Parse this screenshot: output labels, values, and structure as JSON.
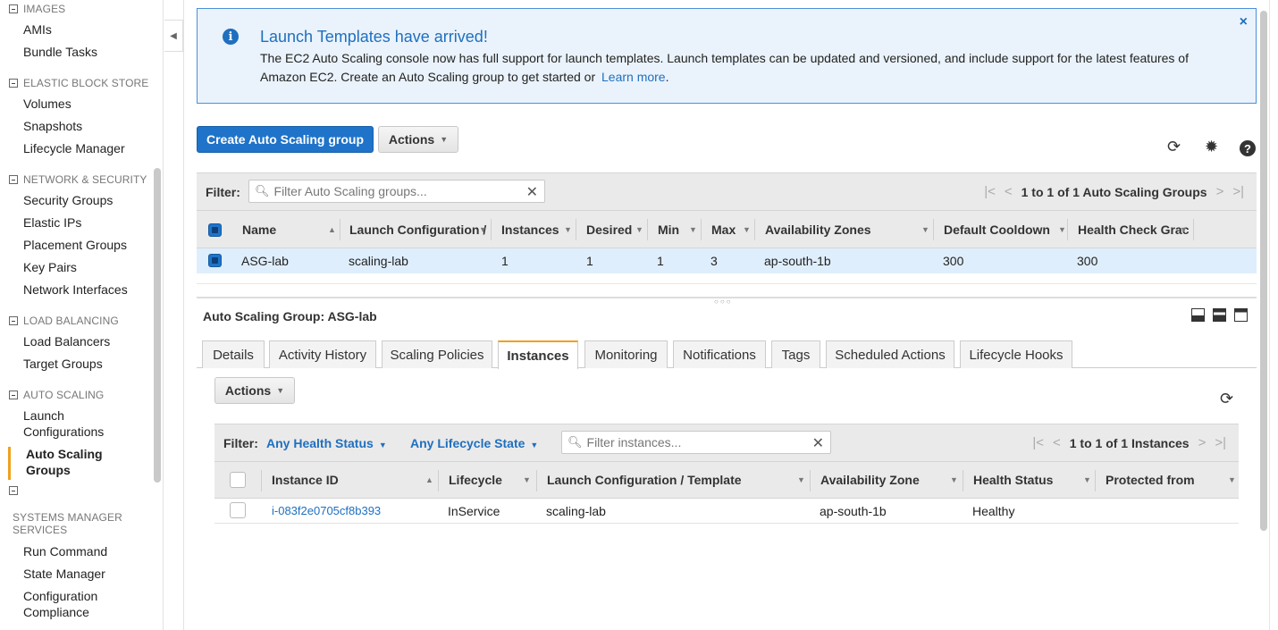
{
  "sidebar": {
    "images_section": "IMAGES",
    "images_items": [
      "AMIs",
      "Bundle Tasks"
    ],
    "ebs_section": "ELASTIC BLOCK STORE",
    "ebs_items": [
      "Volumes",
      "Snapshots",
      "Lifecycle Manager"
    ],
    "network_section": "NETWORK & SECURITY",
    "network_items": [
      "Security Groups",
      "Elastic IPs",
      "Placement Groups",
      "Key Pairs",
      "Network Interfaces"
    ],
    "lb_section": "LOAD BALANCING",
    "lb_items": [
      "Load Balancers",
      "Target Groups"
    ],
    "as_section": "AUTO SCALING",
    "as_items": [
      "Launch Configurations",
      "Auto Scaling Groups"
    ],
    "ssm_section": "SYSTEMS MANAGER SERVICES",
    "ssm_items": [
      "Run Command",
      "State Manager",
      "Configuration Compliance"
    ]
  },
  "banner": {
    "title": "Launch Templates have arrived!",
    "text": "The EC2 Auto Scaling console now has full support for launch templates. Launch templates can be updated and versioned, and include support for the latest features of Amazon EC2. Create an Auto Scaling group to get started or",
    "link": "Learn more",
    "link_suffix": ".",
    "close": "×"
  },
  "toolbar": {
    "create_label": "Create Auto Scaling group",
    "actions_label": "Actions"
  },
  "groups_filter": {
    "label": "Filter:",
    "placeholder": "Filter Auto Scaling groups...",
    "pager_text": "1 to 1 of 1 Auto Scaling Groups"
  },
  "groups_table": {
    "columns": [
      "Name",
      "Launch Configuration /",
      "Instances",
      "Desired",
      "Min",
      "Max",
      "Availability Zones",
      "Default Cooldown",
      "Health Check Grac"
    ],
    "rows": [
      {
        "name": "ASG-lab",
        "launch_config": "scaling-lab",
        "instances": "1",
        "desired": "1",
        "min": "1",
        "max": "3",
        "zones": "ap-south-1b",
        "cooldown": "300",
        "grace": "300"
      }
    ]
  },
  "detail": {
    "title": "Auto Scaling Group: ASG-lab",
    "tabs": [
      "Details",
      "Activity History",
      "Scaling Policies",
      "Instances",
      "Monitoring",
      "Notifications",
      "Tags",
      "Scheduled Actions",
      "Lifecycle Hooks"
    ],
    "active_tab": "Instances",
    "actions_label": "Actions"
  },
  "instances_filter": {
    "label": "Filter:",
    "health_dropdown": "Any Health Status",
    "lifecycle_dropdown": "Any Lifecycle State",
    "placeholder": "Filter instances...",
    "pager_text": "1 to 1 of 1 Instances"
  },
  "instances_table": {
    "columns": [
      "Instance ID",
      "Lifecycle",
      "Launch Configuration / Template",
      "Availability Zone",
      "Health Status",
      "Protected from"
    ],
    "rows": [
      {
        "id": "i-083f2e0705cf8b393",
        "lifecycle": "InService",
        "launch_config": "scaling-lab",
        "zone": "ap-south-1b",
        "health": "Healthy",
        "protected": ""
      }
    ]
  },
  "icons": [
    "refresh-icon",
    "gear-icon",
    "help-icon",
    "info-icon",
    "close-icon",
    "search-icon"
  ],
  "colors": {
    "accent": "#1f73c9",
    "link": "#1f6fbf",
    "active_tab": "#f0a020",
    "banner_bg": "#eaf3fb"
  }
}
